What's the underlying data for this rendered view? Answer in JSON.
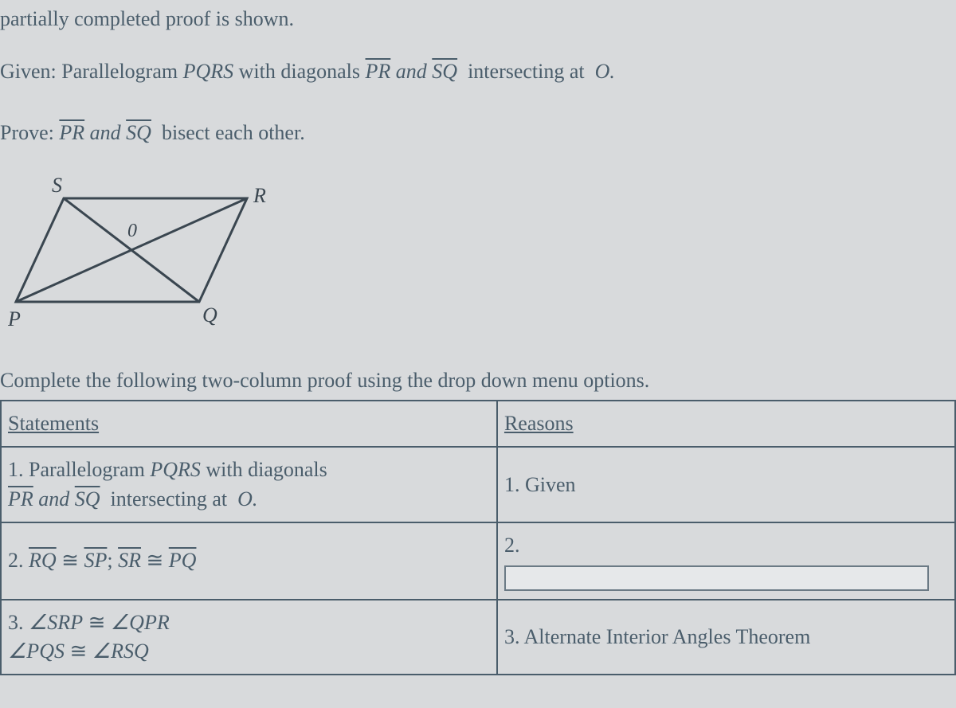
{
  "intro": "partially completed proof is shown.",
  "given": {
    "label": "Given:",
    "pre": "Parallelogram",
    "pqrs": "PQRS",
    "mid": "with diagonals",
    "diag1": "PR",
    "and": "and",
    "diag2": "SQ",
    "post": "intersecting at",
    "point": "O."
  },
  "prove": {
    "label": "Prove:",
    "diag1": "PR",
    "and": "and",
    "diag2": "SQ",
    "post": "bisect each other."
  },
  "diagram": {
    "labels": {
      "S": "S",
      "R": "R",
      "O": "0",
      "P": "P",
      "Q": "Q"
    }
  },
  "complete": "Complete the following two-column proof using the drop down menu options.",
  "headers": {
    "statements": "Statements",
    "reasons": "Reasons"
  },
  "rows": {
    "r1": {
      "stmt_num": "1.",
      "stmt_a": "Parallelogram",
      "stmt_pqrs": "PQRS",
      "stmt_b": "with diagonals",
      "diag1": "PR",
      "and": "and",
      "diag2": "SQ",
      "tail": "intersecting at",
      "point": "O.",
      "reason_num": "1.",
      "reason": "Given"
    },
    "r2": {
      "stmt_num": "2.",
      "seg1a": "RQ",
      "cong": "≅",
      "seg1b": "SP",
      "sep": ";",
      "seg2a": "SR",
      "seg2b": "PQ",
      "reason_num": "2."
    },
    "r3": {
      "stmt_num": "3.",
      "ang1a": "∠SRP",
      "cong": "≅",
      "ang1b": "∠QPR",
      "ang2a": "∠PQS",
      "ang2b": "∠RSQ",
      "reason_num": "3.",
      "reason": "Alternate Interior Angles Theorem"
    }
  }
}
